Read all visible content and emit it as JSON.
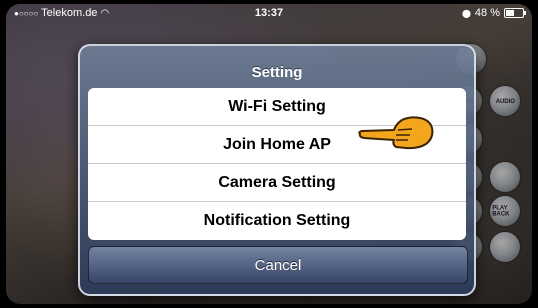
{
  "statusbar": {
    "carrier": "Telekom.de",
    "time": "13:37",
    "battery_text": "48 %",
    "battery_level": 0.48
  },
  "dialog": {
    "title": "Setting",
    "items": [
      {
        "label": "Wi-Fi Setting"
      },
      {
        "label": "Join Home AP"
      },
      {
        "label": "Camera Setting"
      },
      {
        "label": "Notification Setting"
      }
    ],
    "cancel_label": "Cancel"
  },
  "side_icons": [
    "VIDEO",
    "AUDIO",
    "",
    "",
    "",
    "PLAY BACK",
    "",
    ""
  ],
  "colors": {
    "pointer": "#f2a51d",
    "dialog_bg": "#3c4f78"
  }
}
